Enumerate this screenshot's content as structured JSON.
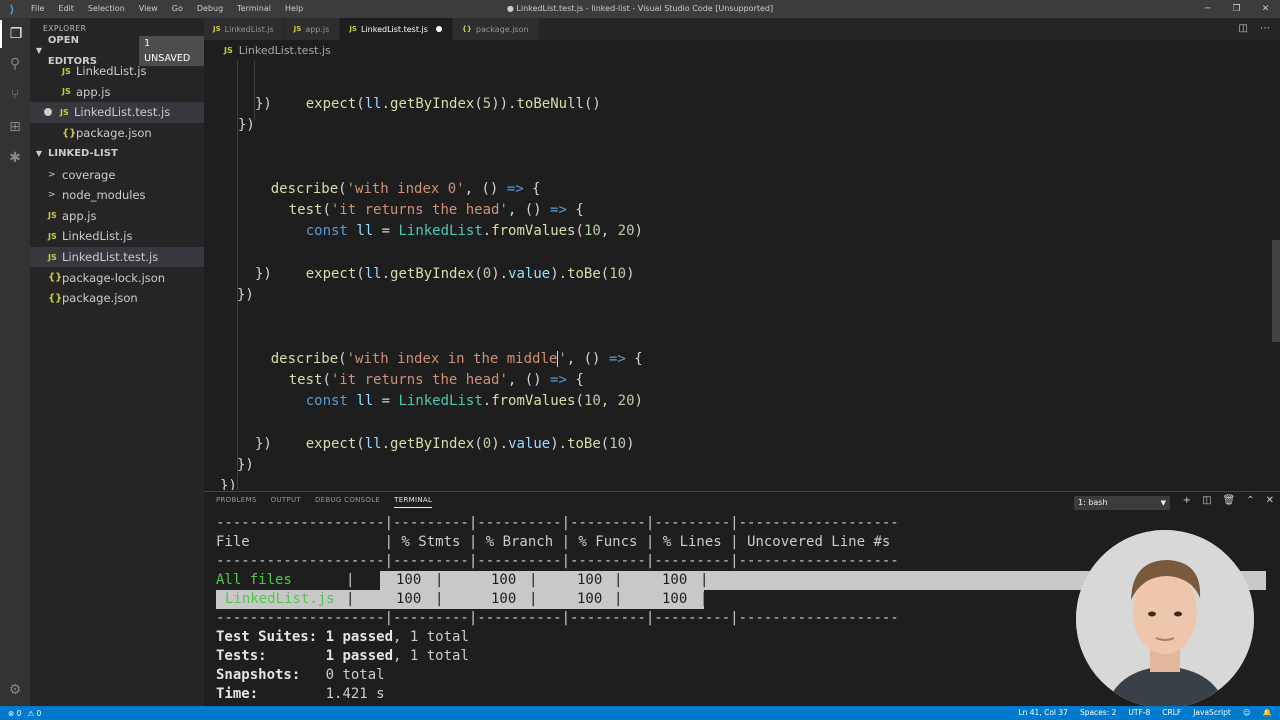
{
  "window": {
    "title": "● LinkedList.test.js - linked-list - Visual Studio Code [Unsupported]",
    "menu": [
      "File",
      "Edit",
      "Selection",
      "View",
      "Go",
      "Debug",
      "Terminal",
      "Help"
    ]
  },
  "sidebar": {
    "title": "EXPLORER",
    "open_editors_label": "OPEN EDITORS",
    "unsaved_badge": "1 UNSAVED",
    "open_editors": [
      {
        "icon": "JS",
        "name": "LinkedList.js"
      },
      {
        "icon": "JS",
        "name": "app.js"
      },
      {
        "icon": "JS",
        "name": "LinkedList.test.js"
      },
      {
        "icon": "{}",
        "name": "package.json"
      }
    ],
    "project_label": "LINKED-LIST",
    "tree": [
      {
        "icon": ">",
        "name": "coverage"
      },
      {
        "icon": ">",
        "name": "node_modules"
      },
      {
        "icon": "JS",
        "name": "app.js"
      },
      {
        "icon": "JS",
        "name": "LinkedList.js"
      },
      {
        "icon": "JS",
        "name": "LinkedList.test.js"
      },
      {
        "icon": "{}",
        "name": "package-lock.json"
      },
      {
        "icon": "{}",
        "name": "package.json"
      }
    ]
  },
  "tabs": [
    {
      "icon": "JS",
      "label": "LinkedList.js"
    },
    {
      "icon": "JS",
      "label": "app.js"
    },
    {
      "icon": "JS",
      "label": "LinkedList.test.js"
    },
    {
      "icon": "{}",
      "label": "package.json"
    }
  ],
  "breadcrumb": {
    "icon": "JS",
    "file": "LinkedList.test.js"
  },
  "code": {
    "l1": [
      "expect",
      "(",
      "ll",
      ".",
      "getByIndex",
      "(",
      "5",
      ")).",
      "toBeNull",
      "()"
    ],
    "l2": "})",
    "l3": "})",
    "l5": [
      "describe",
      "(",
      "'with index 0'",
      ", () ",
      "=>",
      " {"
    ],
    "l6": [
      "test",
      "(",
      "'it returns the head'",
      ", () ",
      "=>",
      " {"
    ],
    "l7": [
      "const",
      " ",
      "ll",
      " = ",
      "LinkedList",
      ".",
      "fromValues",
      "(",
      "10",
      ", ",
      "20",
      ")"
    ],
    "l9": [
      "expect",
      "(",
      "ll",
      ".",
      "getByIndex",
      "(",
      "0",
      ").",
      "value",
      ").",
      "toBe",
      "(",
      "10",
      ")"
    ],
    "l10": "})",
    "l11": "})",
    "l13": [
      "describe",
      "(",
      "'with index in the middle",
      "'",
      ", () ",
      "=>",
      " {"
    ],
    "l14": [
      "test",
      "(",
      "'it returns the head'",
      ", () ",
      "=>",
      " {"
    ],
    "l15": [
      "const",
      " ",
      "ll",
      " = ",
      "LinkedList",
      ".",
      "fromValues",
      "(",
      "10",
      ", ",
      "20",
      ")"
    ],
    "l17": [
      "expect",
      "(",
      "ll",
      ".",
      "getByIndex",
      "(",
      "0",
      ").",
      "value",
      ").",
      "toBe",
      "(",
      "10",
      ")"
    ],
    "l18": "})",
    "l19": "})",
    "l20": "})"
  },
  "panel": {
    "tabs": [
      "PROBLEMS",
      "OUTPUT",
      "DEBUG CONSOLE",
      "TERMINAL"
    ],
    "terminal_select": "1: bash",
    "terminal": {
      "sep": "--------------------|---------|----------|---------|---------|-------------------",
      "header": "File                | % Stmts | % Branch | % Funcs | % Lines | Uncovered Line #s ",
      "row_all_name": "All files",
      "row_file_name": "LinkedList.js",
      "stmts": "100",
      "branch": "100",
      "funcs": "100",
      "lines": "100",
      "suites_label": "Test Suites:",
      "suites_passed": "1 passed",
      "suites_total": ", 1 total",
      "tests_label": "Tests:",
      "tests_passed": "1 passed",
      "tests_total": ", 1 total",
      "snap_label": "Snapshots:",
      "snap_value": "0 total",
      "time_label": "Time:",
      "time_value": "1.421 s"
    }
  },
  "statusbar": {
    "errors": "⊗ 0",
    "warnings": "⚠ 0",
    "position": "Ln 41, Col 37",
    "spaces": "Spaces: 2",
    "encoding": "UTF-8",
    "eol": "CRLF",
    "language": "JavaScript"
  },
  "colors": {
    "accent": "#007acc",
    "editor_bg": "#1e1e1e",
    "sidebar_bg": "#252526",
    "string": "#ce9178",
    "function": "#dcdcaa",
    "keyword": "#569cd6",
    "variable": "#9cdcfe",
    "class": "#4ec9b0",
    "number": "#b5cea8",
    "pass_green": "#4ec94e"
  }
}
